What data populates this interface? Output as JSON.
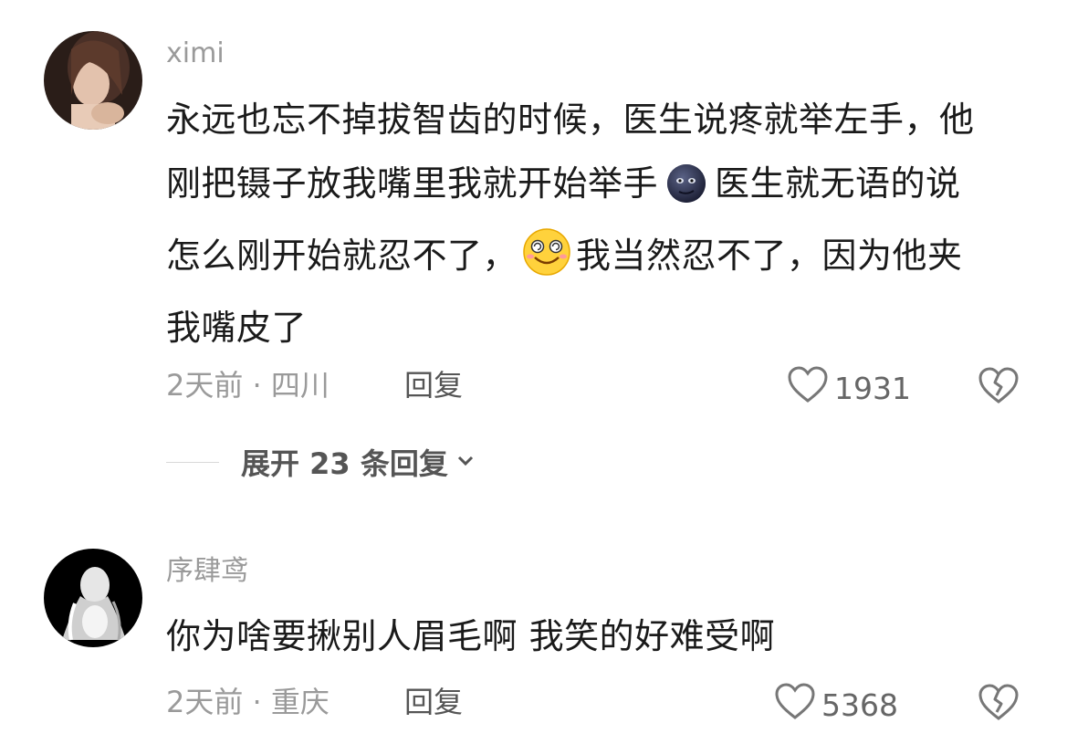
{
  "comments": [
    {
      "username": "ximi",
      "text_parts": [
        "永远也忘不掉拔智齿的时候，医生说疼就举左手，他刚把镊子放我嘴里我就开始举手",
        "医生就无语的说怎么刚开始就忍不了，",
        "我当然忍不了，因为他夹我嘴皮了"
      ],
      "emojis": [
        "dark-moon-face-emoji",
        "dizzy-smile-face-emoji"
      ],
      "time": "2天前",
      "location": "四川",
      "reply_label": "回复",
      "likes": "1931",
      "expand_label": "展开 23 条回复"
    },
    {
      "username": "序肆鸢",
      "text": "你为啥要揪别人眉毛啊 我笑的好难受啊",
      "time": "2天前",
      "location": "重庆",
      "reply_label": "回复",
      "likes": "5368"
    }
  ],
  "separator": "·",
  "colors": {
    "username": "#9a9a9a",
    "body_text": "#1a1a1a",
    "meta": "#9a9a9a",
    "reply": "#555555",
    "background": "#ffffff"
  }
}
